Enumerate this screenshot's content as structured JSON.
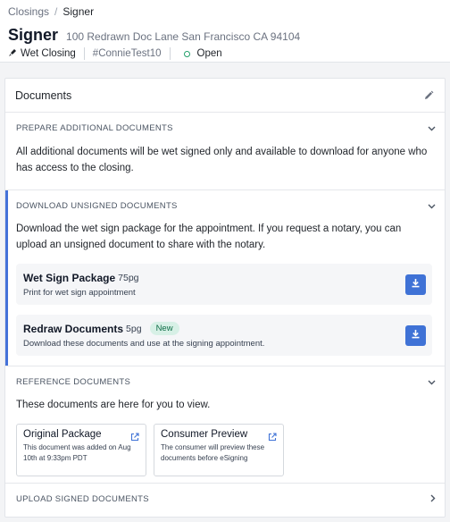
{
  "breadcrumb": {
    "parent": "Closings",
    "separator": "/",
    "current": "Signer"
  },
  "header": {
    "title": "Signer",
    "address": "100 Redrawn Doc Lane San Francisco CA 94104",
    "closing_type": "Wet Closing",
    "tag": "#ConnieTest10",
    "status": "Open"
  },
  "documents": {
    "title": "Documents",
    "sections": {
      "prepare": {
        "label": "PREPARE ADDITIONAL DOCUMENTS",
        "text": "All additional documents will be wet signed only and available to download for anyone who has access to the closing."
      },
      "download": {
        "label": "DOWNLOAD UNSIGNED DOCUMENTS",
        "text": "Download the wet sign package for the appointment. If you request a notary, you can upload an unsigned document to share with the notary.",
        "items": [
          {
            "name": "Wet Sign Package",
            "pages": "75pg",
            "badge": "",
            "description": "Print for wet sign appointment"
          },
          {
            "name": "Redraw Documents",
            "pages": "5pg",
            "badge": "New",
            "description": "Download these documents and use at the signing appointment."
          }
        ]
      },
      "reference": {
        "label": "REFERENCE DOCUMENTS",
        "text": "These documents are here for you to view.",
        "cards": [
          {
            "title": "Original Package",
            "description": "This document was added on Aug 10th at 9:33pm PDT"
          },
          {
            "title": "Consumer Preview",
            "description": "The consumer will preview these documents before eSigning"
          }
        ]
      },
      "upload": {
        "label": "UPLOAD SIGNED DOCUMENTS"
      }
    }
  },
  "icons": {
    "closing_type": "pen-nib-icon",
    "status": "status-dot-icon",
    "edit": "pencil-icon",
    "expand": "chevron-down-icon",
    "collapse": "chevron-right-icon",
    "download": "download-icon",
    "external": "external-link-icon"
  },
  "colors": {
    "accent": "#3f72d6",
    "active_bar": "#4472d9",
    "status_open": "#22a06b",
    "badge_bg": "#d7f0e6",
    "badge_text": "#0f6e47"
  }
}
